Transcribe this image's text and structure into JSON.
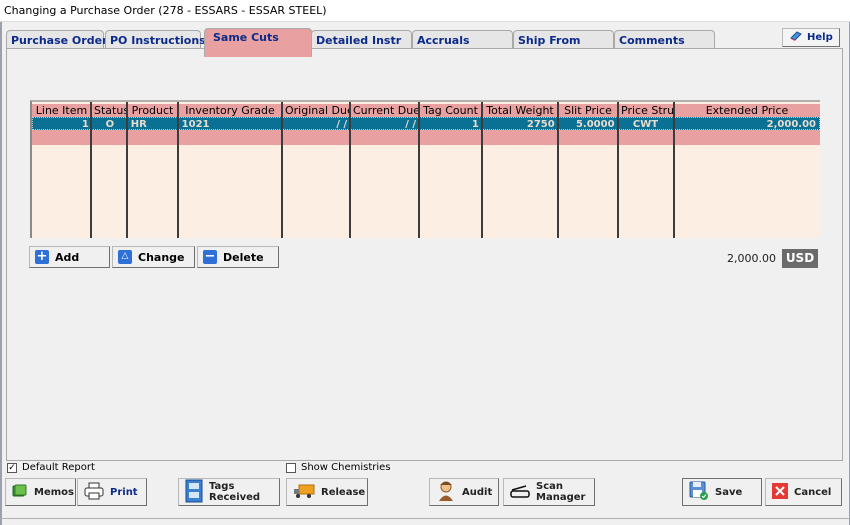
{
  "window": {
    "title": "Changing a Purchase Order  (278 - ESSARS -  ESSAR STEEL)"
  },
  "tabs": [
    {
      "label": "Purchase Order",
      "active": false
    },
    {
      "label": "PO Instructions",
      "active": false
    },
    {
      "label": "Same Cuts",
      "active": true
    },
    {
      "label": "Detailed Instr",
      "active": false
    },
    {
      "label": "Accruals",
      "active": false
    },
    {
      "label": "Ship From",
      "active": false
    },
    {
      "label": "Comments",
      "active": false
    }
  ],
  "help": {
    "label": "Help",
    "icon": "help-book-icon"
  },
  "grid": {
    "columns": [
      "Line Item",
      "Status",
      "Product",
      "Inventory Grade",
      "Original Due",
      "Current Due",
      "Tag Count",
      "Total Weight",
      "Slit Price",
      "Price Stru",
      "Extended Price"
    ],
    "rows": [
      {
        "line_item": "1",
        "status": "O",
        "product": "HR",
        "inventory_grade": "1021",
        "original_due": "/  /",
        "current_due": "/  /",
        "tag_count": "1",
        "total_weight": "2750",
        "slit_price": "5.0000",
        "price_structure": "CWT",
        "extended_price": "2,000.00",
        "selected": true
      }
    ]
  },
  "grid_actions": {
    "add": {
      "label": "Add",
      "icon": "plus-icon"
    },
    "change": {
      "label": "Change",
      "icon": "triangle-up-icon"
    },
    "delete": {
      "label": "Delete",
      "icon": "minus-icon"
    }
  },
  "totals": {
    "amount": "2,000.00",
    "currency": "USD"
  },
  "options": {
    "default_report": {
      "label": "Default Report",
      "checked": true
    },
    "show_chemistries": {
      "label": "Show Chemistries",
      "checked": false
    }
  },
  "footer_buttons": {
    "memos": {
      "label": "Memos",
      "icon": "book-icon"
    },
    "print": {
      "label": "Print",
      "icon": "printer-icon"
    },
    "tags_received": {
      "label": "Tags Received",
      "icon": "file-cabinet-icon"
    },
    "release": {
      "label": "Release",
      "icon": "truck-icon"
    },
    "audit": {
      "label": "Audit",
      "icon": "detective-icon"
    },
    "scan_manager": {
      "label": "Scan Manager",
      "icon": "scanner-icon"
    },
    "save": {
      "label": "Save",
      "icon": "floppy-disk-icon"
    },
    "cancel": {
      "label": "Cancel",
      "icon": "red-x-icon"
    }
  },
  "colors": {
    "tab_text": "#0b2a8a",
    "active_tab": "#e8a1a0",
    "grid_header": "#e8a1a0",
    "grid_selected": "#0a7195",
    "grid_body": "#fdeee4",
    "currency_badge": "#6b6b6b"
  }
}
